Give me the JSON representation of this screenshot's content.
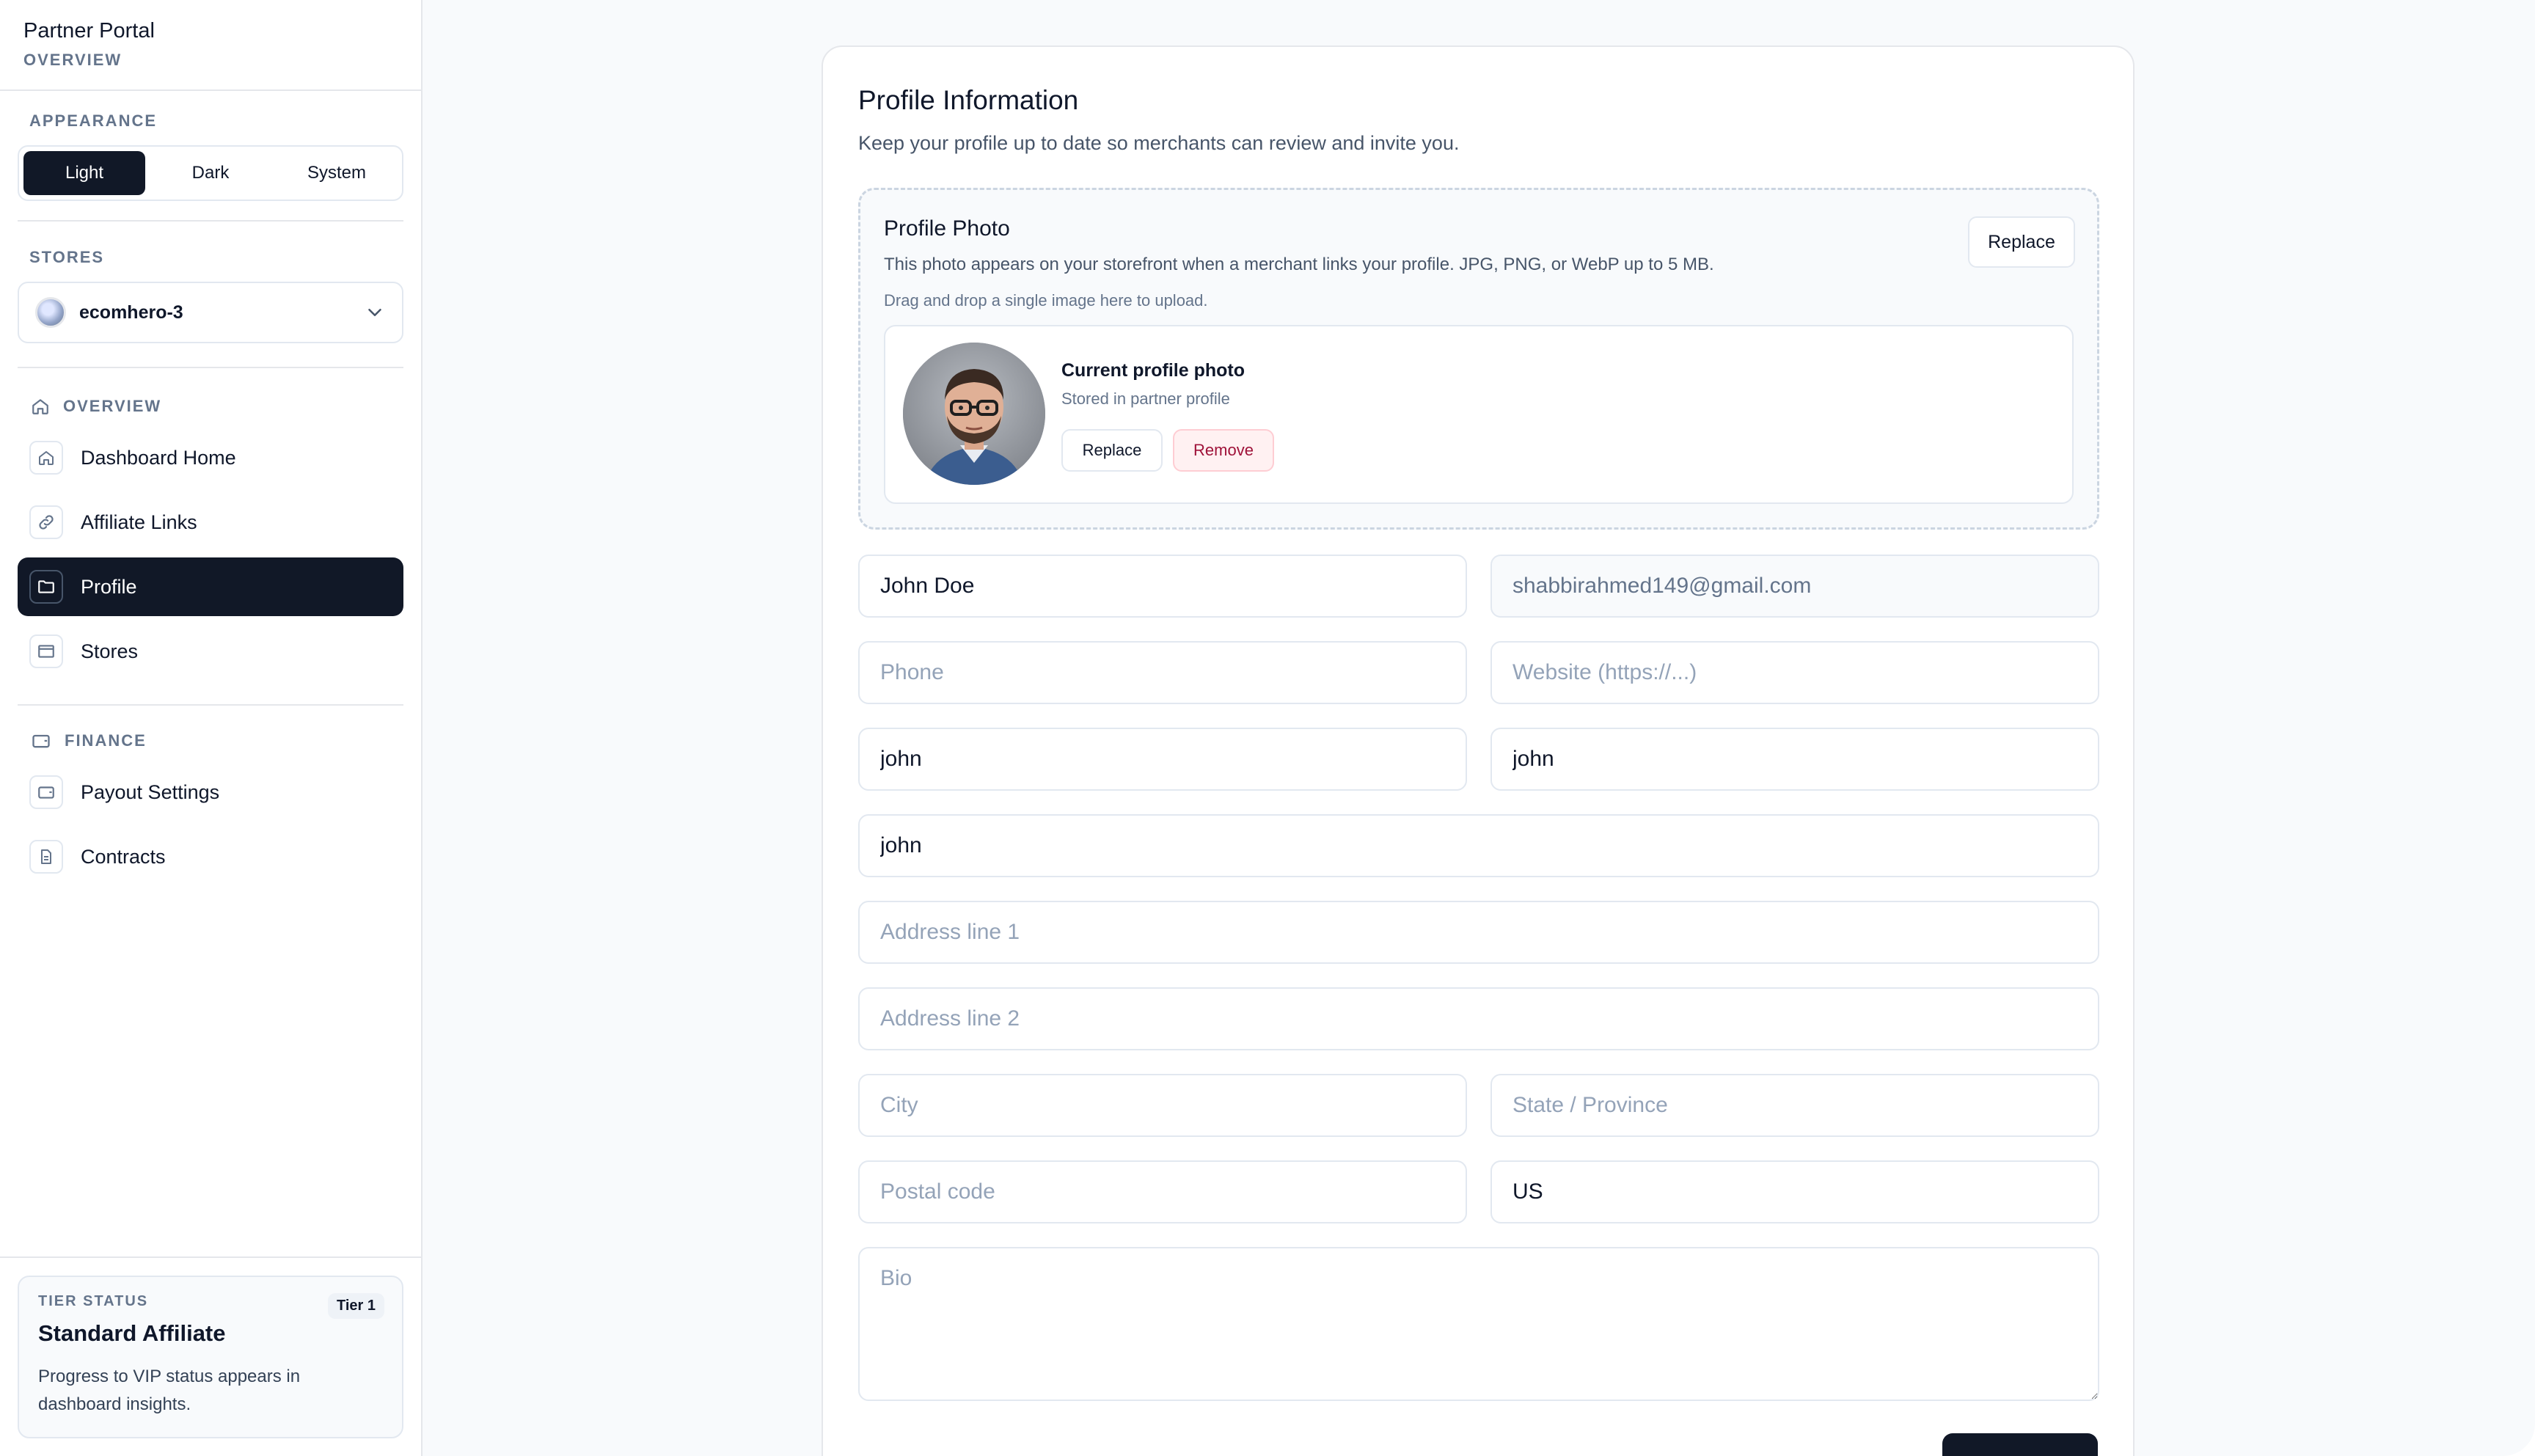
{
  "brand": {
    "title": "Partner Portal",
    "subtitle": "OVERVIEW"
  },
  "appearance": {
    "label": "APPEARANCE",
    "options": [
      "Light",
      "Dark",
      "System"
    ],
    "selected": "Light"
  },
  "stores": {
    "label": "STORES",
    "selected": "ecomhero-3"
  },
  "nav": {
    "overview_label": "OVERVIEW",
    "overview_items": [
      "Dashboard Home",
      "Affiliate Links",
      "Profile",
      "Stores"
    ],
    "finance_label": "FINANCE",
    "finance_items": [
      "Payout Settings",
      "Contracts"
    ],
    "active": "Profile"
  },
  "tier": {
    "label": "TIER STATUS",
    "badge": "Tier 1",
    "name": "Standard Affiliate",
    "description": "Progress to VIP status appears in dashboard insights."
  },
  "profile": {
    "title": "Profile Information",
    "subtitle": "Keep your profile up to date so merchants can review and invite you.",
    "photo": {
      "title": "Profile Photo",
      "description": "This photo appears on your storefront when a merchant links your profile. JPG, PNG, or WebP up to 5 MB.",
      "hint": "Drag and drop a single image here to upload.",
      "replace_label": "Replace",
      "current_title": "Current profile photo",
      "current_sub": "Stored in partner profile",
      "current_replace_label": "Replace",
      "remove_label": "Remove"
    },
    "fields": {
      "name": {
        "value": "John Doe",
        "placeholder": ""
      },
      "email": {
        "value": "shabbirahmed149@gmail.com",
        "placeholder": ""
      },
      "phone": {
        "value": "",
        "placeholder": "Phone"
      },
      "website": {
        "value": "",
        "placeholder": "Website (https://...)"
      },
      "first": {
        "value": "john",
        "placeholder": ""
      },
      "last": {
        "value": "john",
        "placeholder": ""
      },
      "company": {
        "value": "john",
        "placeholder": ""
      },
      "address1": {
        "value": "",
        "placeholder": "Address line 1"
      },
      "address2": {
        "value": "",
        "placeholder": "Address line 2"
      },
      "city": {
        "value": "",
        "placeholder": "City"
      },
      "state": {
        "value": "",
        "placeholder": "State / Province"
      },
      "postal": {
        "value": "",
        "placeholder": "Postal code"
      },
      "country": {
        "value": "US",
        "placeholder": ""
      },
      "bio": {
        "value": "",
        "placeholder": "Bio"
      }
    }
  }
}
